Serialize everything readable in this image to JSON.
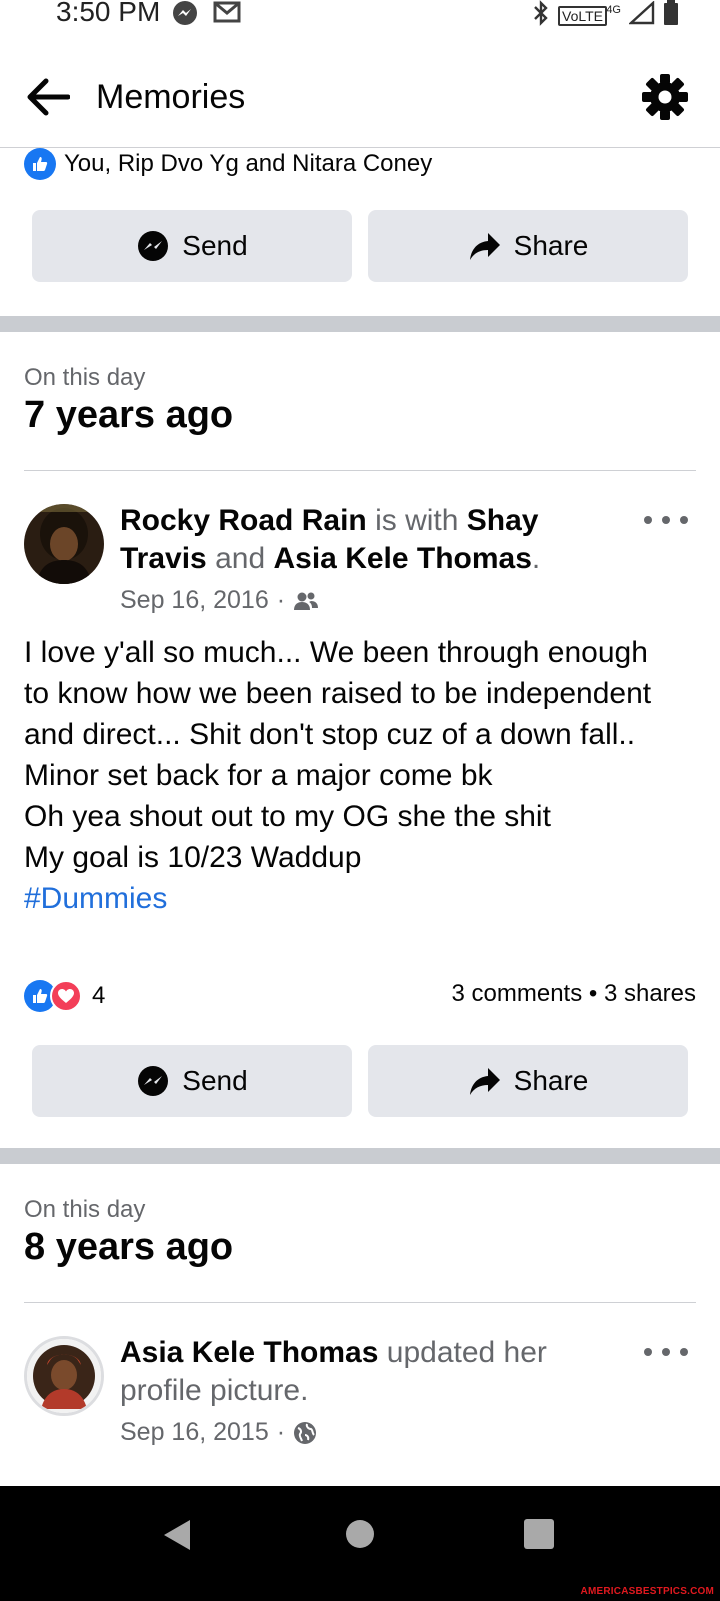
{
  "status_bar": {
    "time": "3:50 PM",
    "network_label": "VoLTE",
    "network_gen": "4G"
  },
  "header": {
    "title": "Memories"
  },
  "prev_post": {
    "reactors_text": "You, Rip Dvo Yg and Nitara Coney",
    "send_label": "Send",
    "share_label": "Share"
  },
  "memory_1": {
    "kicker": "On this day",
    "title": "7 years ago",
    "author": "Rocky Road Rain",
    "with_text": "is with",
    "tag_1_part1": "Shay",
    "tag_1_part2": "Travis",
    "and_text": "and",
    "tag_2": "Asia Kele Thomas",
    "period": ".",
    "date": "Sep 16, 2016",
    "body_lines": [
      "I love y'all so much...  We been through enough",
      "to know how we been raised to be independent",
      "and direct...  Shit don't stop cuz of a down fall..",
      "Minor set back for a major come bk",
      "Oh yea shout out to my OG she the shit",
      "My goal is 10/23 Waddup"
    ],
    "hashtag": "#Dummies",
    "reaction_count": "4",
    "comments_shares": "3 comments • 3 shares",
    "send_label": "Send",
    "share_label": "Share"
  },
  "memory_2": {
    "kicker": "On this day",
    "title": "8 years ago",
    "author": "Asia Kele Thomas",
    "action_part1": "updated her",
    "action_part2": "profile picture.",
    "date": "Sep 16, 2015"
  },
  "watermark": "AMERICASBESTPICS.COM",
  "colors": {
    "facebook_blue": "#1877f2",
    "love_red": "#f33e58",
    "hashtag_blue": "#216fdb",
    "button_gray": "#e4e6eb",
    "secondary_text": "#65676b"
  }
}
